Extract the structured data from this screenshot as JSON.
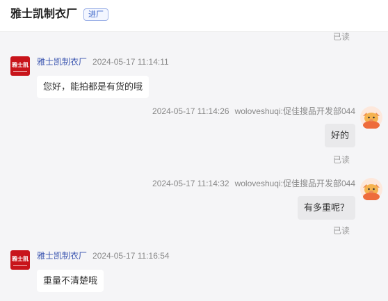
{
  "header": {
    "title": "雅士凯制衣厂",
    "tag": "进厂"
  },
  "read_label": "已读",
  "shop_avatar_text": "雅士凯",
  "messages": [
    {
      "side": "left",
      "name": "雅士凯制衣厂",
      "time": "2024-05-17 11:14:11",
      "text": "您好，能拍都是有货的哦"
    },
    {
      "side": "right",
      "name": "woloveshuqi:促佳搜品开发部044",
      "time": "2024-05-17 11:14:26",
      "text": "好的",
      "status": "已读"
    },
    {
      "side": "right",
      "name": "woloveshuqi:促佳搜品开发部044",
      "time": "2024-05-17 11:14:32",
      "text": "有多重呢？",
      "status": "已读"
    },
    {
      "side": "left",
      "name": "雅士凯制衣厂",
      "time": "2024-05-17 11:16:54",
      "text": "重量不清楚哦"
    }
  ]
}
